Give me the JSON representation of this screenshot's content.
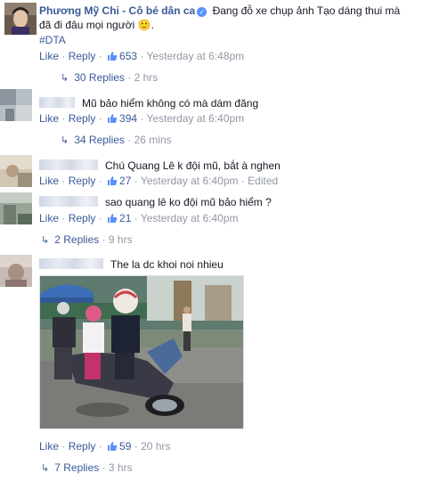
{
  "post": {
    "author": "Phương Mỹ Chi - Cô bé dân ca",
    "text_line1": "Đang đỗ xe chụp ảnh Tạo dáng thui mà",
    "text_line2": "đã đi đâu mọi người",
    "emoji": "🙂",
    "text_end": ".",
    "hashtag": "#DTA",
    "like_label": "Like",
    "reply_label": "Reply",
    "likes": "653",
    "time": "Yesterday at 6:48pm",
    "replies_label": "30 Replies",
    "replies_time": "2 hrs"
  },
  "comments": [
    {
      "text": "Mũ bảo hiểm không có mà dám đăng",
      "like_label": "Like",
      "reply_label": "Reply",
      "likes": "394",
      "time": "Yesterday at 6:40pm",
      "replies_label": "34 Replies",
      "replies_time": "26 mins"
    },
    {
      "text": "Chú Quang Lê k đội mũ, bắt à nghen",
      "like_label": "Like",
      "reply_label": "Reply",
      "likes": "27",
      "time": "Yesterday at 6:40pm",
      "edited": "Edited"
    },
    {
      "text": "sao quang lê ko đội mũ bảo hiểm ?",
      "like_label": "Like",
      "reply_label": "Reply",
      "likes": "21",
      "time": "Yesterday at 6:40pm",
      "replies_label": "2 Replies",
      "replies_time": "9 hrs"
    },
    {
      "text": "The la dc khoi noi nhieu",
      "like_label": "Like",
      "reply_label": "Reply",
      "likes": "59",
      "time": "20 hrs",
      "replies_label": "7 Replies",
      "replies_time": "3 hrs"
    }
  ],
  "icons": {
    "thumb": "thumbs-up-icon",
    "verified": "verified-badge-icon",
    "reply_arrow": "reply-arrow-icon"
  },
  "colors": {
    "link": "#3b5998",
    "meta": "#9197a3",
    "text": "#141823"
  }
}
